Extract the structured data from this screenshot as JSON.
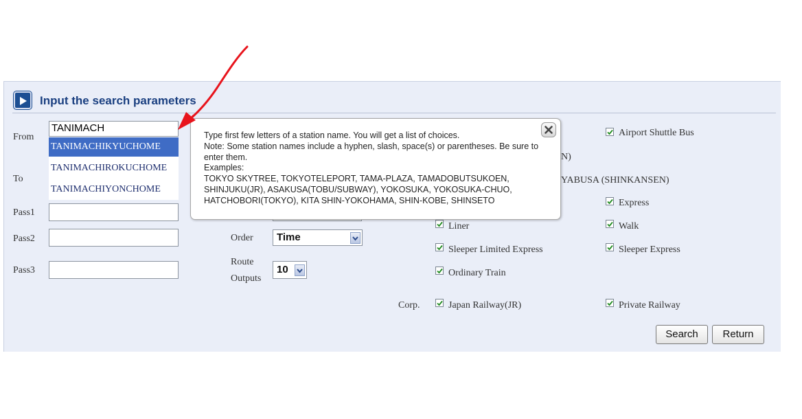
{
  "panel": {
    "title": "Input the search parameters"
  },
  "form": {
    "from_label": "From",
    "from_value": "TANIMACH",
    "to_label": "To",
    "pass1_label": "Pass1",
    "pass2_label": "Pass2",
    "pass3_label": "Pass3",
    "order_label": "Order",
    "order_value": "Time",
    "route_outputs_label_1": "Route",
    "route_outputs_label_2": "Outputs",
    "route_outputs_value": "10",
    "corp_label": "Corp."
  },
  "autocomplete": {
    "items": [
      "TANIMACHIKYUCHOME",
      "TANIMACHIROKUCHOME",
      "TANIMACHIYONCHOME"
    ],
    "selected_index": 0
  },
  "tooltip": {
    "line1": "Type first few letters of a station name. You will get a list of choices.",
    "line2": "Note: Some station names include a hyphen, slash, space(s) or parentheses. Be sure to enter them.",
    "line3": "Examples:",
    "line4": "TOKYO SKYTREE, TOKYOTELEPORT, TAMA-PLAZA, TAMADOBUTSUKOEN, SHINJUKU(JR), ASAKUSA(TOBU/SUBWAY), YOKOSUKA, YOKOSUKA-CHUO, HATCHOBORI(TOKYO), KITA SHIN-YOKOHAMA, SHIN-KOBE, SHINSETO"
  },
  "options": {
    "airport_shuttle_bus": "Airport Shuttle Bus",
    "partial_1": "N)",
    "partial_2": "YABUSA (SHINKANSEN)",
    "express": "Express",
    "liner": "Liner",
    "walk": "Walk",
    "sleeper_limited_express": "Sleeper Limited Express",
    "sleeper_express": "Sleeper Express",
    "ordinary_train": "Ordinary Train",
    "japan_railway": "Japan Railway(JR)",
    "private_railway": "Private Railway"
  },
  "buttons": {
    "search": "Search",
    "return": "Return"
  },
  "colors": {
    "title": "#1a3f80",
    "selection": "#3f6cc5",
    "panel_bg": "#eaeef8",
    "annotation_arrow": "#e8141c"
  }
}
